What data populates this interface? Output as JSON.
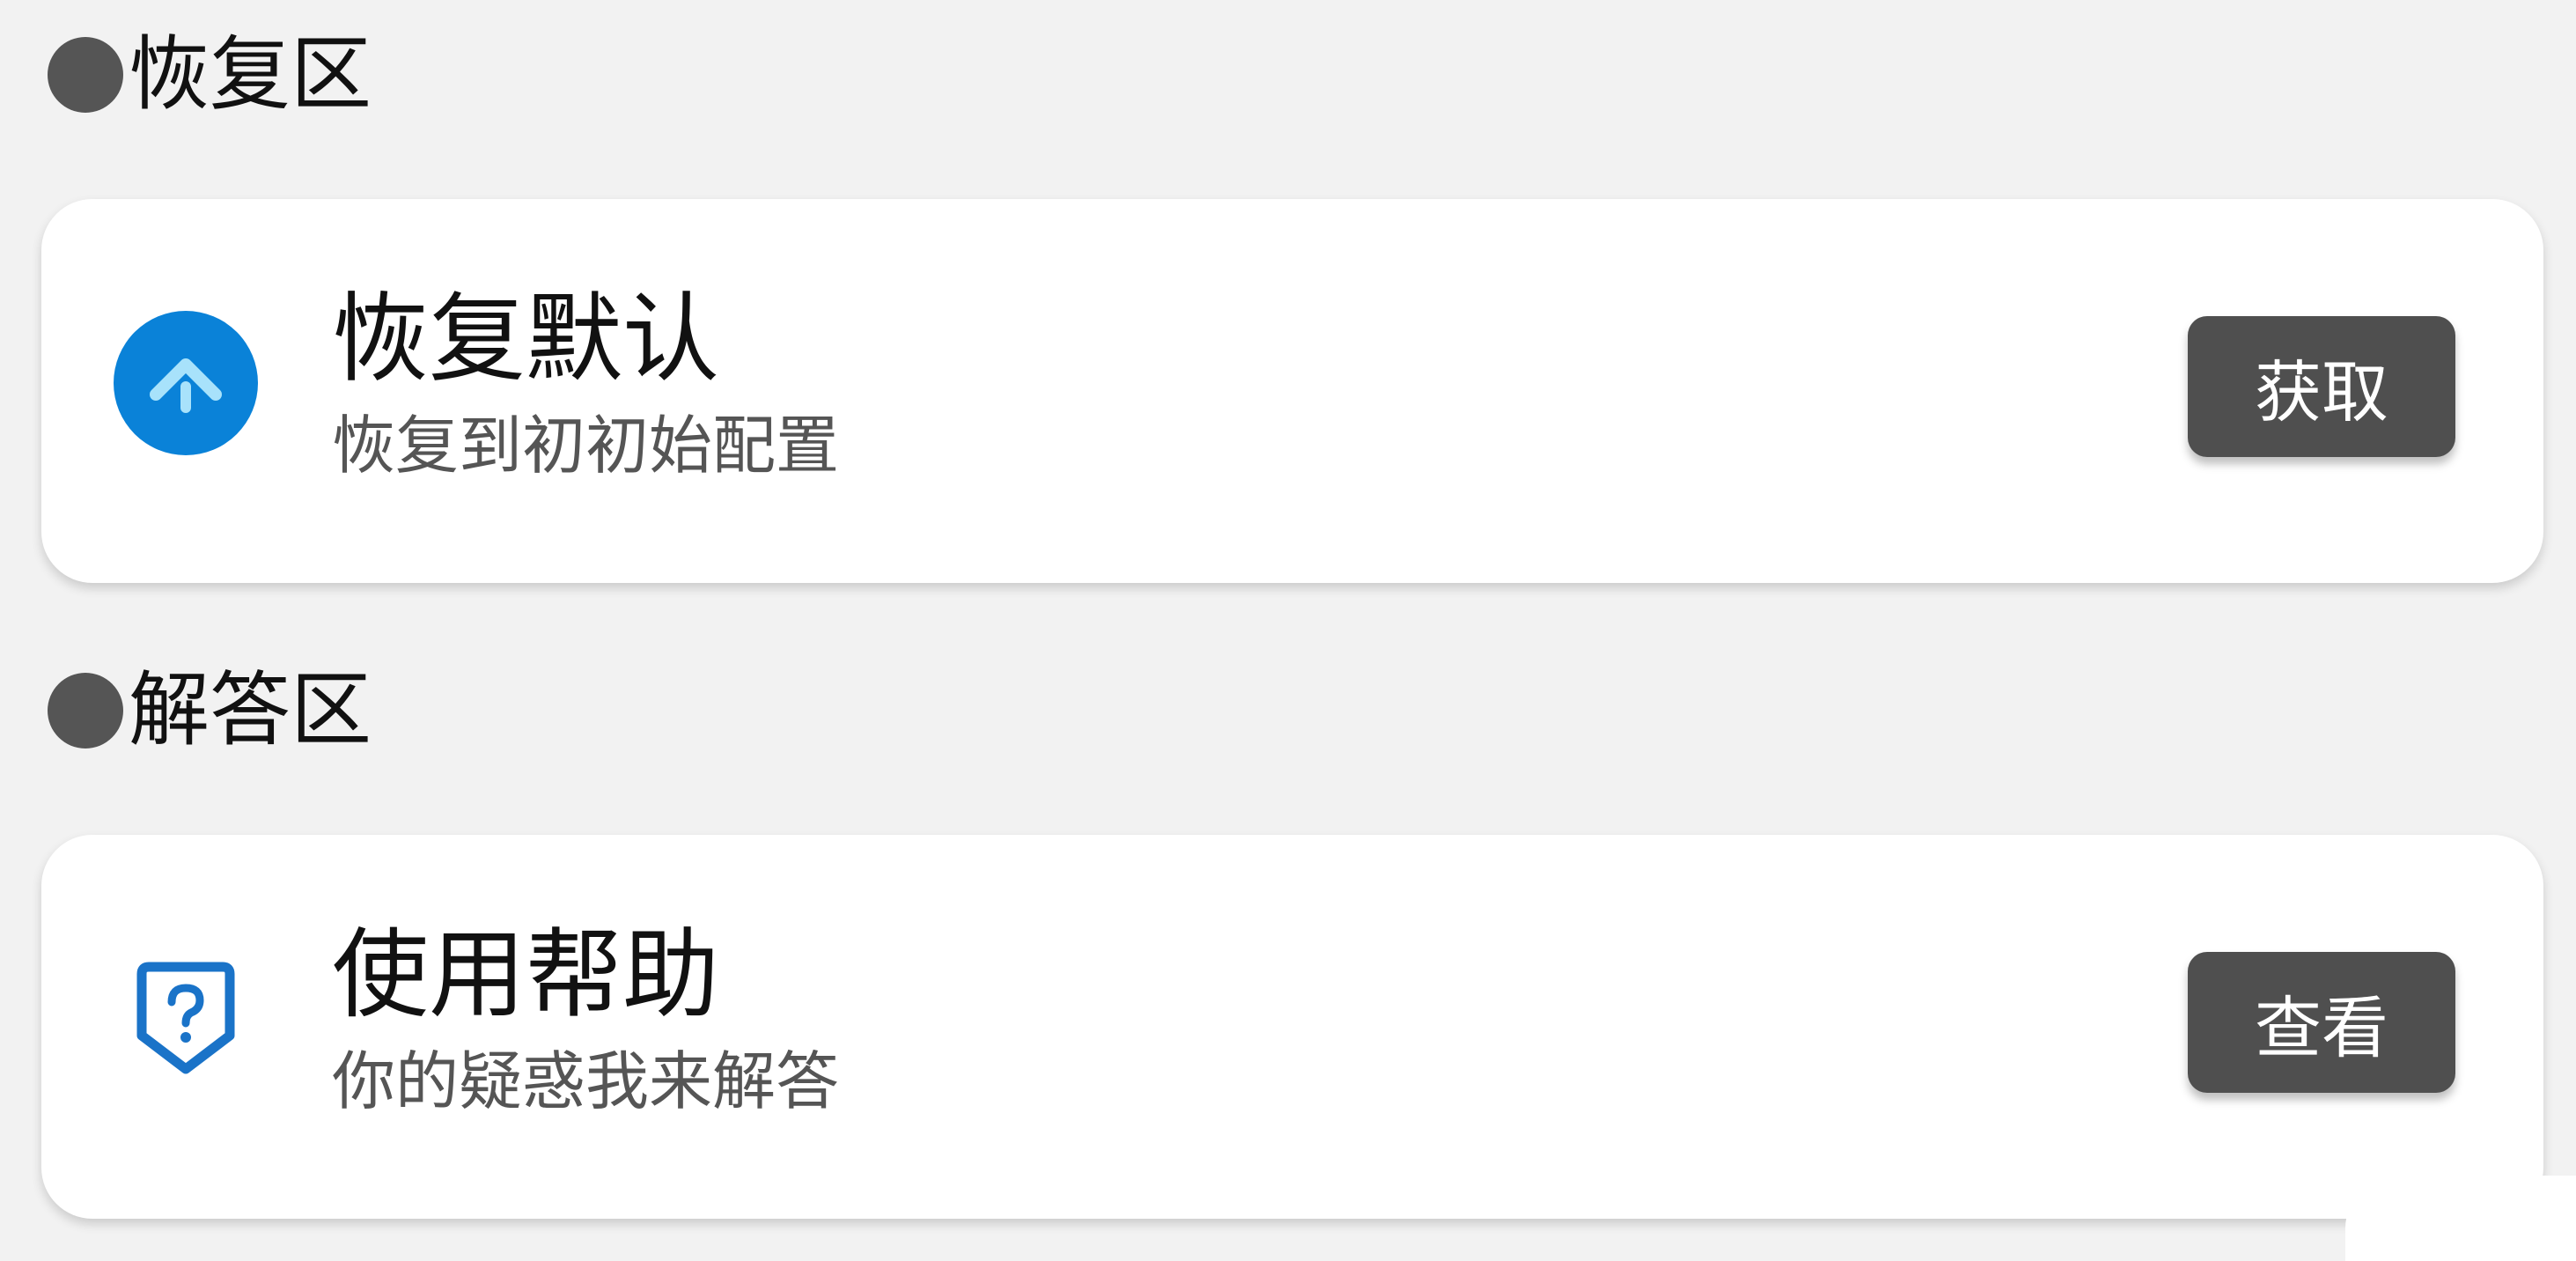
{
  "sections": [
    {
      "header": "恢复区",
      "item": {
        "title": "恢复默认",
        "subtitle": "恢复到初初始配置",
        "icon": "restore-arrow-icon",
        "icon_color": "#0a82d8",
        "action_label": "获取"
      }
    },
    {
      "header": "解答区",
      "item": {
        "title": "使用帮助",
        "subtitle": "你的疑惑我来解答",
        "icon": "help-shield-icon",
        "icon_color": "#1a73c8",
        "action_label": "查看"
      }
    }
  ],
  "colors": {
    "background": "#f2f2f2",
    "card": "#ffffff",
    "button": "#4f4f4f",
    "section_dot": "#555555"
  }
}
